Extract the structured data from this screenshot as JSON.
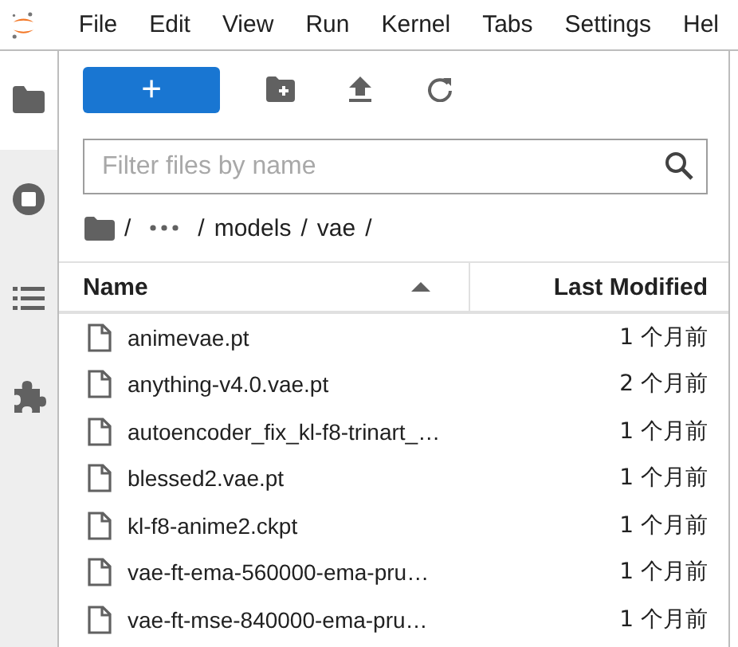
{
  "menu": [
    {
      "label": "File"
    },
    {
      "label": "Edit"
    },
    {
      "label": "View"
    },
    {
      "label": "Run"
    },
    {
      "label": "Kernel"
    },
    {
      "label": "Tabs"
    },
    {
      "label": "Settings"
    },
    {
      "label": "Hel"
    }
  ],
  "sidebar_tabs": [
    {
      "kind": "folder",
      "selected": true
    },
    {
      "kind": "stop",
      "selected": false
    },
    {
      "kind": "list",
      "selected": false
    },
    {
      "kind": "puzzle",
      "selected": false
    }
  ],
  "toolbar": {
    "new_button": "+"
  },
  "filter": {
    "placeholder": "Filter files by name"
  },
  "breadcrumb": [
    {
      "kind": "sep",
      "text": "/"
    },
    {
      "kind": "more"
    },
    {
      "kind": "sep",
      "text": "/"
    },
    {
      "kind": "dir",
      "text": "models"
    },
    {
      "kind": "sep",
      "text": "/"
    },
    {
      "kind": "dir",
      "text": "vae"
    },
    {
      "kind": "sep",
      "text": "/"
    }
  ],
  "columns": [
    {
      "label": "Name",
      "sorted": true
    },
    {
      "label": "Last Modified",
      "sorted": false
    }
  ],
  "files": [
    {
      "name": "animevae.pt",
      "modified": "1 个月前"
    },
    {
      "name": "anything-v4.0.vae.pt",
      "modified": "2 个月前"
    },
    {
      "name": "autoencoder_fix_kl-f8-trinart_…",
      "modified": "1 个月前"
    },
    {
      "name": "blessed2.vae.pt",
      "modified": "1 个月前"
    },
    {
      "name": "kl-f8-anime2.ckpt",
      "modified": "1 个月前"
    },
    {
      "name": "vae-ft-ema-560000-ema-pru…",
      "modified": "1 个月前"
    },
    {
      "name": "vae-ft-mse-840000-ema-pru…",
      "modified": "1 个月前"
    }
  ]
}
